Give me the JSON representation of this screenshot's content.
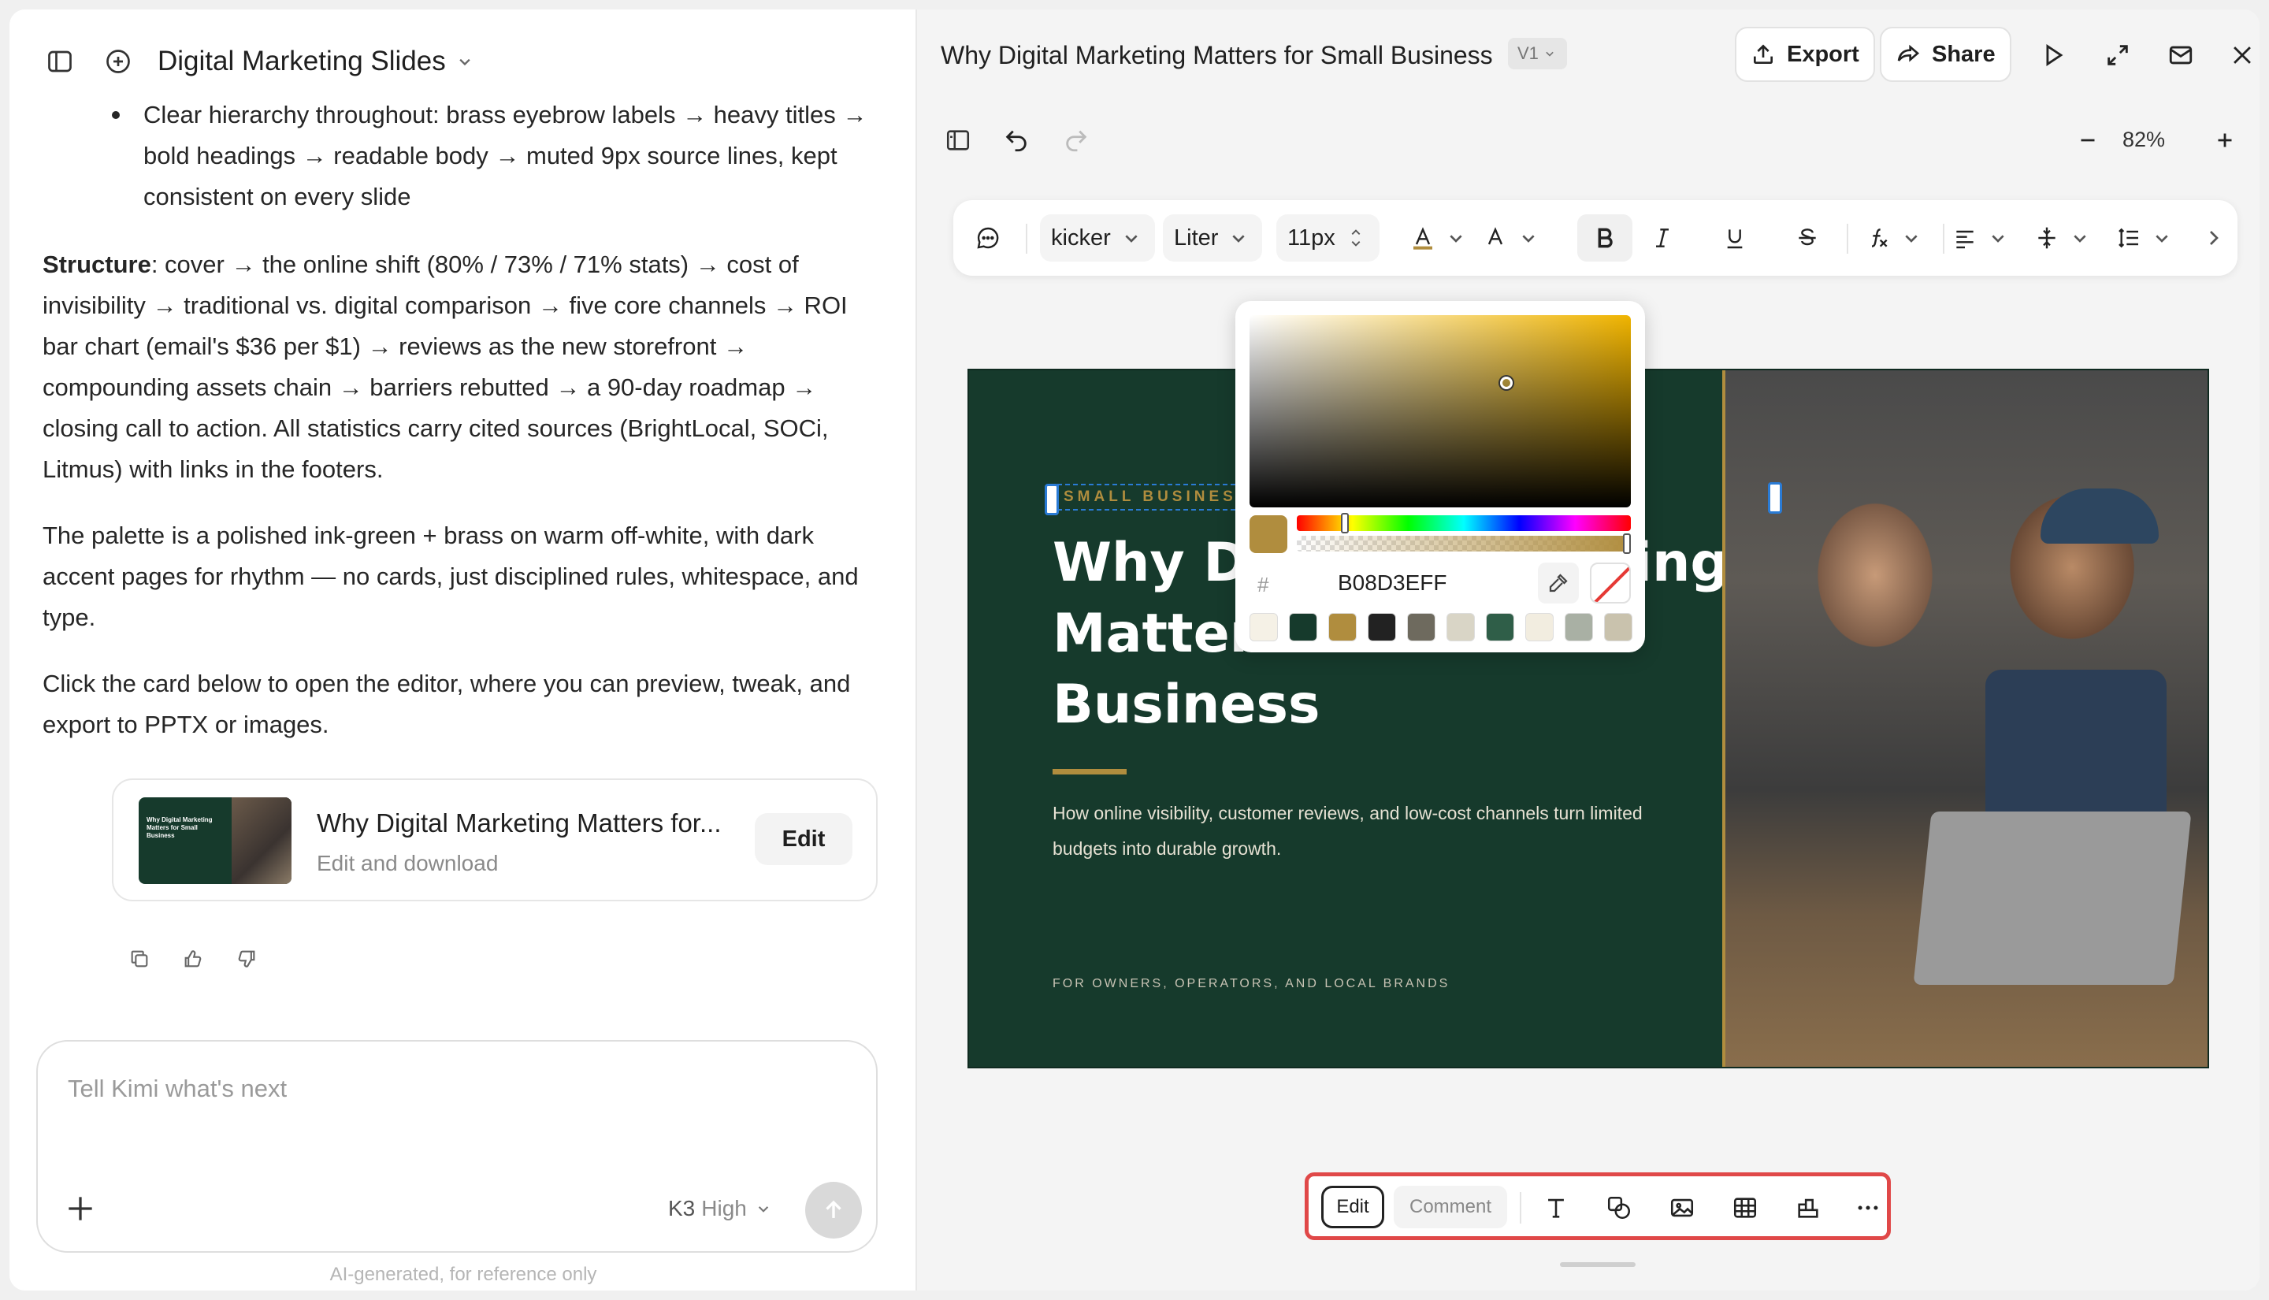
{
  "left": {
    "project_title": "Digital Marketing Slides",
    "bullet_text": "Clear hierarchy throughout: brass eyebrow labels → heavy titles → bold headings → readable body → muted 9px source lines, kept consistent on every slide",
    "structure_label": "Structure",
    "structure_text": ": cover → the online shift (80% / 73% / 71% stats) → cost of invisibility → traditional vs. digital comparison → five core channels → ROI bar chart (email's $36 per $1) → reviews as the new storefront → compounding assets chain → barriers rebutted → a 90-day roadmap → closing call to action. All statistics carry cited sources (BrightLocal, SOCi, Litmus) with links in the footers.",
    "palette_text": "The palette is a polished ink-green + brass on warm off-white, with dark accent pages for rhythm — no cards, just disciplined rules, whitespace, and type.",
    "click_text": "Click the card below to open the editor, where you can preview, tweak, and export to PPTX or images.",
    "card": {
      "title": "Why Digital Marketing Matters for...",
      "subtitle": "Edit and download",
      "edit_label": "Edit",
      "thumb_text": "Why Digital Marketing Matters for Small Business"
    },
    "composer": {
      "placeholder": "Tell Kimi what's next",
      "model": "K3",
      "level": "High"
    },
    "disclaimer": "AI-generated, for reference only"
  },
  "editor": {
    "doc_title": "Why Digital Marketing Matters for Small Business",
    "version": "V1",
    "export_label": "Export",
    "share_label": "Share",
    "zoom": "82%",
    "format": {
      "style": "kicker",
      "font": "Liter",
      "size": "11px"
    },
    "picker": {
      "hash": "#",
      "hex": "B08D3EFF",
      "swatches": [
        "#f5f1e6",
        "#163a2c",
        "#b08d3e",
        "#222222",
        "#6e6a5e",
        "#d9d5c6",
        "#2f5e48",
        "#f2ede0",
        "#a9b0a4",
        "#c9c2ad"
      ]
    },
    "modes": {
      "edit": "Edit",
      "comment": "Comment"
    }
  },
  "slide": {
    "kicker": "SMALL BUSINES",
    "title": "Why Digital Marketing Matters for Small Business",
    "body": "How online visibility, customer reviews, and low-cost channels turn limited budgets into durable growth.",
    "footer": "FOR OWNERS, OPERATORS, AND LOCAL BRANDS",
    "colors": {
      "bg": "#163a2c",
      "accent": "#b08d3e"
    }
  }
}
